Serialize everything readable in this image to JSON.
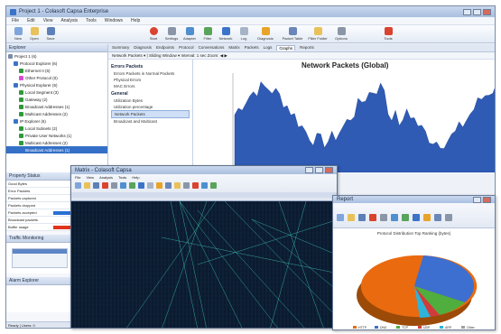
{
  "main_window": {
    "title": "Project 1 - Colasoft Capsa Enterprise",
    "menu": [
      "File",
      "Edit",
      "View",
      "Analysis",
      "Tools",
      "Windows",
      "Help"
    ],
    "toolbar": [
      "New",
      "Open",
      "Save",
      "Start",
      "Settings",
      "Adapter",
      "Filter",
      "Network",
      "Log",
      "Diagnosis",
      "Packet Table",
      "Filter Folder",
      "Options",
      "Tools"
    ]
  },
  "explorer": {
    "title": "Explorer",
    "items": [
      {
        "label": "Project 1 (6)",
        "color": "#7a8ba8"
      },
      {
        "label": "Protocol Explorer (6)",
        "color": "#3b73c8"
      },
      {
        "label": "Ethernet II (6)",
        "color": "#2f9a3a"
      },
      {
        "label": "Other Protocol (0)",
        "color": "#d94ad2"
      },
      {
        "label": "Physical Explorer (6)",
        "color": "#3b73c8"
      },
      {
        "label": "Local Segment (3)",
        "color": "#2f9a3a"
      },
      {
        "label": "Gateway (2)",
        "color": "#2f9a3a"
      },
      {
        "label": "Broadcast Addresses (1)",
        "color": "#2f9a3a"
      },
      {
        "label": "Multicast Addresses (2)",
        "color": "#2f9a3a"
      },
      {
        "label": "IP Explorer (6)",
        "color": "#3b73c8"
      },
      {
        "label": "Local Subnets (2)",
        "color": "#2f9a3a"
      },
      {
        "label": "Private User Networks (1)",
        "color": "#2f9a3a"
      },
      {
        "label": "Multicast Addresses (2)",
        "color": "#2f9a3a"
      },
      {
        "label": "Broadcast Addresses (1)",
        "color": "#3470c7"
      }
    ]
  },
  "tabs": [
    "Summary",
    "Diagnosis",
    "Endpoints",
    "Protocol",
    "Conversations",
    "Matrix",
    "Packets",
    "Logs",
    "Graphs",
    "Reports"
  ],
  "active_tab": "Graphs",
  "subbar": "Network Packets  ▾   |   Sliding Window  ▾   Interval: 1 sec   Zoom:  ◀  ▶",
  "graph_list": {
    "groups": [
      {
        "title": "Errors Packets",
        "items": [
          "Errors Packets in Normal Packets",
          "Physical Errors",
          "MAC Errors"
        ]
      },
      {
        "title": "General",
        "items": [
          "Utilization Bytes",
          "Utilization percentage",
          "Network Packets",
          "Broadcast and Multicast"
        ]
      }
    ],
    "selected": "Network Packets"
  },
  "graph": {
    "title": "Network Packets (Global)"
  },
  "props": {
    "title": "Property Status",
    "rows": [
      {
        "label": "Good Bytes",
        "color": ""
      },
      {
        "label": "Error Packets",
        "color": ""
      },
      {
        "label": "Packets captured",
        "color": ""
      },
      {
        "label": "Packets dropped",
        "color": ""
      },
      {
        "label": "Packets accepted",
        "color": "#2a6fd4"
      },
      {
        "label": "Broadcast packets",
        "color": ""
      },
      {
        "label": "Buffer usage",
        "color": "#e0341c"
      }
    ],
    "section2": "Traffic Monitoring",
    "section3": "Alarm Explorer"
  },
  "status": "Ready  |  Users: 0",
  "matrix_window": {
    "title": "Matrix - Colasoft Capsa",
    "menu": [
      "File",
      "View",
      "Analysis",
      "Tools",
      "Help"
    ]
  },
  "pie_window": {
    "title": "Report",
    "chart_title": "Protocol Distribution Top Ranking (bytes)",
    "legend": [
      "HTTP",
      "DNS",
      "TCP",
      "UDP",
      "ARP",
      "Other"
    ]
  },
  "colors": {
    "graph_fill": "#2f5bb5",
    "pie_orange": "#ea6a0f",
    "pie_blue": "#3c6fcf",
    "matrix_bg": "#0b1a2c"
  }
}
